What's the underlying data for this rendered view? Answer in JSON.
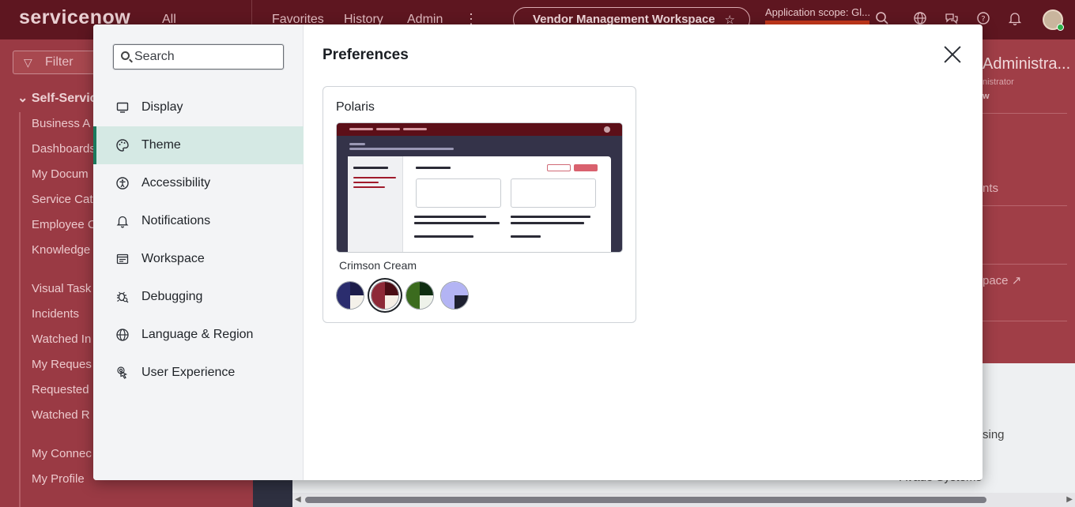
{
  "topbar": {
    "logo": "servicenow",
    "all": "All",
    "favorites": "Favorites",
    "history": "History",
    "admin": "Admin",
    "workspace_pill": "Vendor Management Workspace",
    "scope_label": "Application scope: Gl...",
    "icons": [
      "search-icon",
      "globe-icon",
      "chat-icon",
      "help-icon",
      "bell-icon"
    ]
  },
  "leftnav": {
    "filter_placeholder": "Filter",
    "section": "Self-Servic",
    "links": [
      "Business A",
      "Dashboards",
      "My Docum",
      "Service Cat",
      "Employee C",
      "Knowledge",
      "Visual Task",
      "Incidents",
      "Watched In",
      "My Reques",
      "Requested",
      "Watched R",
      "My Connec",
      "My Profile"
    ]
  },
  "right_panel": {
    "name": "Administra...",
    "sub": "nistrator",
    "sub2": "w",
    "item1": "nts",
    "item2": "pace",
    "bg_text1": "sing",
    "bg_text2": "Avaue Systems"
  },
  "modal": {
    "search_placeholder": "Search",
    "title": "Preferences",
    "menu": [
      {
        "label": "Display",
        "icon": "monitor-icon"
      },
      {
        "label": "Theme",
        "icon": "palette-icon"
      },
      {
        "label": "Accessibility",
        "icon": "accessibility-icon"
      },
      {
        "label": "Notifications",
        "icon": "bell-icon"
      },
      {
        "label": "Workspace",
        "icon": "workspace-icon"
      },
      {
        "label": "Debugging",
        "icon": "bug-icon"
      },
      {
        "label": "Language & Region",
        "icon": "globe-icon"
      },
      {
        "label": "User Experience",
        "icon": "touch-icon"
      }
    ],
    "active_item": "Theme",
    "card": {
      "title": "Polaris",
      "selected_theme": "Crimson Cream",
      "swatches": [
        {
          "name": "navy",
          "colors": [
            "#2b2d6e",
            "#1c1d4a",
            "#2b2d6e",
            "#f4f1ea"
          ]
        },
        {
          "name": "crimson",
          "colors": [
            "#8e2a37",
            "#4a0d14",
            "#8e2a37",
            "#f6efe6"
          ],
          "selected": true
        },
        {
          "name": "green",
          "colors": [
            "#3b6b1e",
            "#0f2e12",
            "#3b6b1e",
            "#eef2ea"
          ]
        },
        {
          "name": "lavender",
          "colors": [
            "#b3b4f4",
            "#b3b4f4",
            "#b3b4f4",
            "#1d2030"
          ]
        }
      ]
    }
  }
}
